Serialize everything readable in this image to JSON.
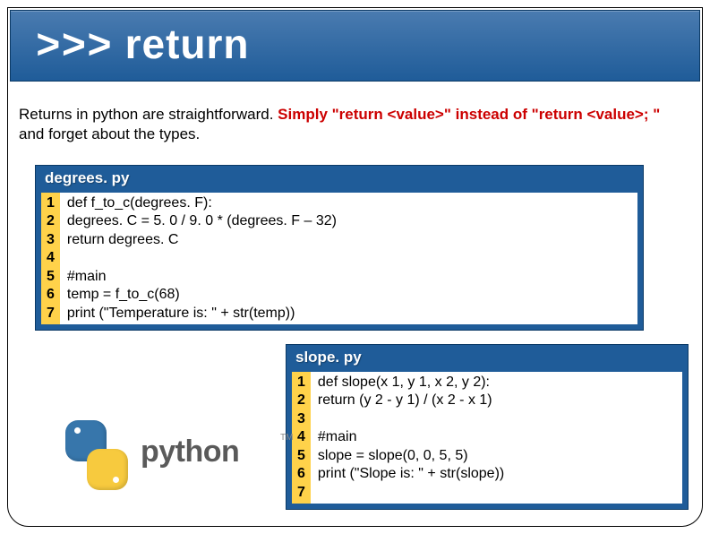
{
  "title": {
    "prompt": ">>>",
    "word": "return"
  },
  "intro": {
    "plain1": "Returns in python are straightforward.  ",
    "hl": "Simply \"return <value>\" instead of \"return <value>; \"",
    "plain2": " and forget about the types."
  },
  "win1": {
    "caption": "degrees. py",
    "nums": "1\n2\n3\n4\n5\n6\n7",
    "code": "def f_to_c(degrees. F):\ndegrees. C = 5. 0 / 9. 0 * (degrees. F – 32)\nreturn degrees. C\n\n#main\ntemp = f_to_c(68)\nprint (\"Temperature is: \" + str(temp))"
  },
  "win2": {
    "caption": "slope. py",
    "nums": "1\n2\n3\n4\n5\n6\n7",
    "code": "def slope(x 1, y 1, x 2, y 2):\nreturn (y 2 - y 1) / (x 2 - x 1)\n\n#main\nslope = slope(0, 0, 5, 5)\nprint (\"Slope is: \" + str(slope))\n "
  },
  "logo": {
    "word": "python",
    "tm": "TM"
  }
}
